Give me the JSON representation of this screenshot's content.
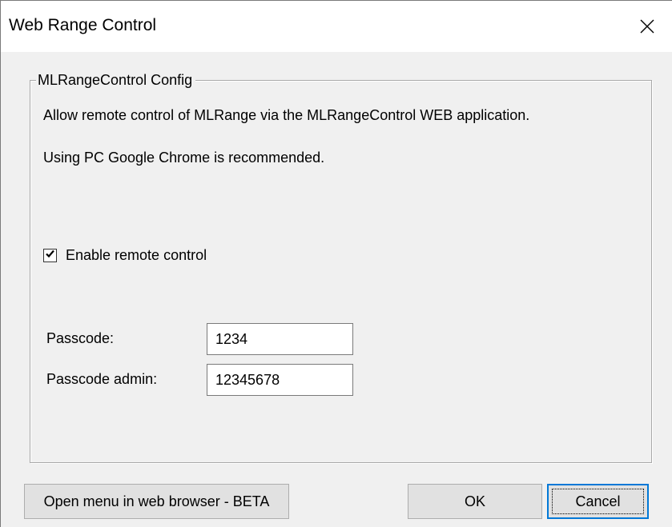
{
  "window": {
    "title": "Web Range Control",
    "close_icon": "close-icon"
  },
  "group": {
    "legend": "MLRangeControl Config",
    "description": "Allow remote control of MLRange via the MLRangeControl WEB application.",
    "recommendation": "Using PC Google Chrome is recommended."
  },
  "remote_control": {
    "label": "Enable remote control",
    "checked": true
  },
  "fields": {
    "passcode_label": "Passcode:",
    "passcode_value": "1234",
    "passcode_admin_label": "Passcode admin:",
    "passcode_admin_value": "12345678"
  },
  "buttons": {
    "open_browser": "Open menu in web browser - BETA",
    "ok": "OK",
    "cancel": "Cancel"
  }
}
